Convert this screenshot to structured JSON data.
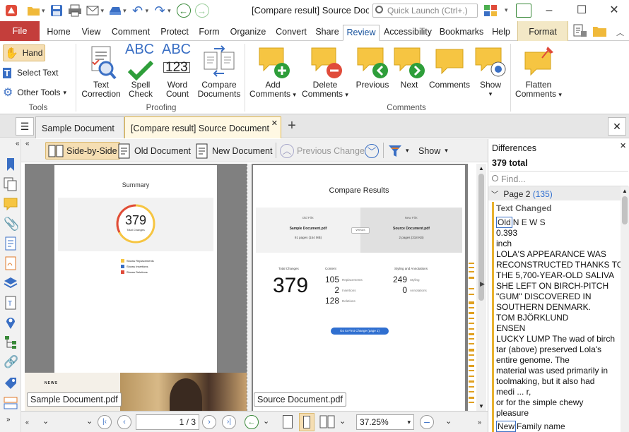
{
  "window": {
    "title": "[Compare result] Source Docu...",
    "quick_launch_placeholder": "Quick Launch (Ctrl+.)"
  },
  "ribbon_tabs": [
    "File",
    "Home",
    "View",
    "Comment",
    "Protect",
    "Form",
    "Organize",
    "Convert",
    "Share",
    "Review",
    "Accessibility",
    "Bookmarks",
    "Help",
    "Format"
  ],
  "active_tab": "Review",
  "tools_group": {
    "label": "Tools",
    "hand": "Hand",
    "select_text": "Select Text",
    "other_tools": "Other Tools"
  },
  "proofing_group": {
    "label": "Proofing",
    "text_correction": [
      "Text",
      "Correction"
    ],
    "spell_check": [
      "Spell",
      "Check"
    ],
    "word_count": [
      "Word",
      "Count"
    ],
    "compare_documents": [
      "Compare",
      "Documents"
    ],
    "spell_icon_text": "ABC",
    "word_icon_text": "ABC",
    "word_icon_num": "123"
  },
  "comments_group": {
    "label": "Comments",
    "add_comments": [
      "Add",
      "Comments"
    ],
    "delete_comments": [
      "Delete",
      "Comments"
    ],
    "previous": "Previous",
    "next": "Next",
    "comments": "Comments",
    "show": "Show",
    "flatten_comments": [
      "Flatten",
      "Comments"
    ]
  },
  "doc_tabs": {
    "tab1": "Sample Document",
    "tab2": "[Compare result] Source Document *"
  },
  "compare_toolbar": {
    "side_by_side": "Side-by-Side",
    "old_document": "Old Document",
    "new_document": "New Document",
    "previous_change": "Previous Change",
    "show": "Show"
  },
  "left_page": {
    "summary_title": "Summary",
    "total_changes": "379",
    "total_changes_label": "Total Changes",
    "legend": [
      "Shows Replacements",
      "Shows Insertions",
      "Shows Deletions"
    ],
    "file_label": "Sample Document.pdf",
    "news_label": "NEWS"
  },
  "right_page": {
    "title": "Compare Results",
    "old_file_label": "Old File:",
    "old_file_name": "Sample Document.pdf",
    "old_file_meta": "91 pages (154 MB)",
    "new_file_label": "New File:",
    "new_file_name": "Source Document.pdf",
    "new_file_meta": "2 pages (318 KB)",
    "versus": "versus",
    "total_changes_head": "Total Changes",
    "total_changes": "379",
    "content_head": "Content",
    "replacements_n": "105",
    "replacements": "Replacements",
    "insertions_n": "2",
    "insertions": "Insertions",
    "deletions_n": "128",
    "deletions": "Deletions",
    "styling_head": "Styling and Annotations",
    "styling_n": "249",
    "styling": "Styling",
    "annotations_n": "0",
    "annotations": "Annotations",
    "goto_button": "Go to First Change (page 1)",
    "file_label": "Source Document.pdf"
  },
  "differences": {
    "title": "Differences",
    "total": "379 total",
    "find_placeholder": "Find...",
    "page_group": "Page 2",
    "page_count": "(135)",
    "section": "Text Changed",
    "old_badge": "Old",
    "lines": [
      "N E W S",
      "0.393",
      " inch",
      "LOLA'S APPEARANCE WAS",
      "RECONSTRUCTED THANKS TO",
      "THE  5,700-YEAR-OLD SALIVA",
      "SHE LEFT ON  BIRCH-PITCH",
      "\"GUM\" DISCOVERED IN",
      "SOUTHERN DENMARK.",
      "TOM BJÖRKLUND",
      "ENSEN",
      "LUCKY LUMP The wad of birch",
      "tar (above)  preserved Lola's",
      "entire genome. The",
      "material was used primarily in",
      "toolmaking,  but it also had",
      "medi ... r,",
      "or for the simple chewy",
      "pleasure"
    ],
    "new_badge": "New",
    "new_text": "Family name"
  },
  "bottom_bar": {
    "page_value": "1",
    "page_total": "/ 3",
    "zoom": "37.25%"
  }
}
